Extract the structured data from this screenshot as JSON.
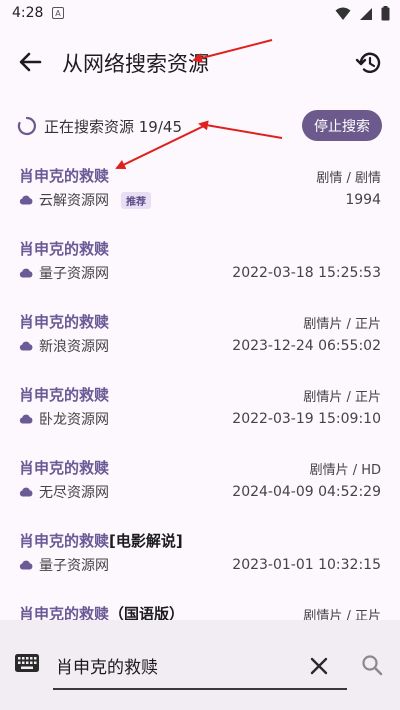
{
  "status_bar": {
    "time": "4:28",
    "app_indicator": "A"
  },
  "toolbar": {
    "title": "从网络搜索资源"
  },
  "progress": {
    "text": "正在搜索资源 19/45",
    "stop_label": "停止搜索"
  },
  "results": [
    {
      "title": "肖申克的救赎",
      "suffix": "",
      "type": "剧情 / 剧情",
      "source": "云解资源网",
      "badge": "推荐",
      "date": "1994"
    },
    {
      "title": "肖申克的救赎",
      "suffix": "",
      "type": "",
      "source": "量子资源网",
      "badge": "",
      "date": "2022-03-18 15:25:53"
    },
    {
      "title": "肖申克的救赎",
      "suffix": "",
      "type": "剧情片 / 正片",
      "source": "新浪资源网",
      "badge": "",
      "date": "2023-12-24 06:55:02"
    },
    {
      "title": "肖申克的救赎",
      "suffix": "",
      "type": "剧情片 / 正片",
      "source": "卧龙资源网",
      "badge": "",
      "date": "2022-03-19 15:09:10"
    },
    {
      "title": "肖申克的救赎",
      "suffix": "",
      "type": "剧情片 / HD",
      "source": "无尽资源网",
      "badge": "",
      "date": "2024-04-09 04:52:29"
    },
    {
      "title": "肖申克的救赎",
      "suffix": "[电影解说]",
      "type": "",
      "source": "量子资源网",
      "badge": "",
      "date": "2023-01-01 10:32:15"
    },
    {
      "title": "肖申克的救赎",
      "suffix": "（国语版）",
      "type": "剧情片 / 正片",
      "source": "",
      "badge": "",
      "date": ""
    }
  ],
  "search": {
    "query": "肖申克的救赎"
  },
  "colors": {
    "accent": "#6c5a8c",
    "title_purple": "#6a5a96",
    "annotation_red": "#e0201c"
  },
  "icons": {
    "back": "arrow-left-icon",
    "history": "history-icon",
    "spinner": "loading-spinner-icon",
    "cloud": "cloud-icon",
    "keyboard": "keyboard-icon",
    "clear": "close-icon",
    "search": "search-icon"
  }
}
